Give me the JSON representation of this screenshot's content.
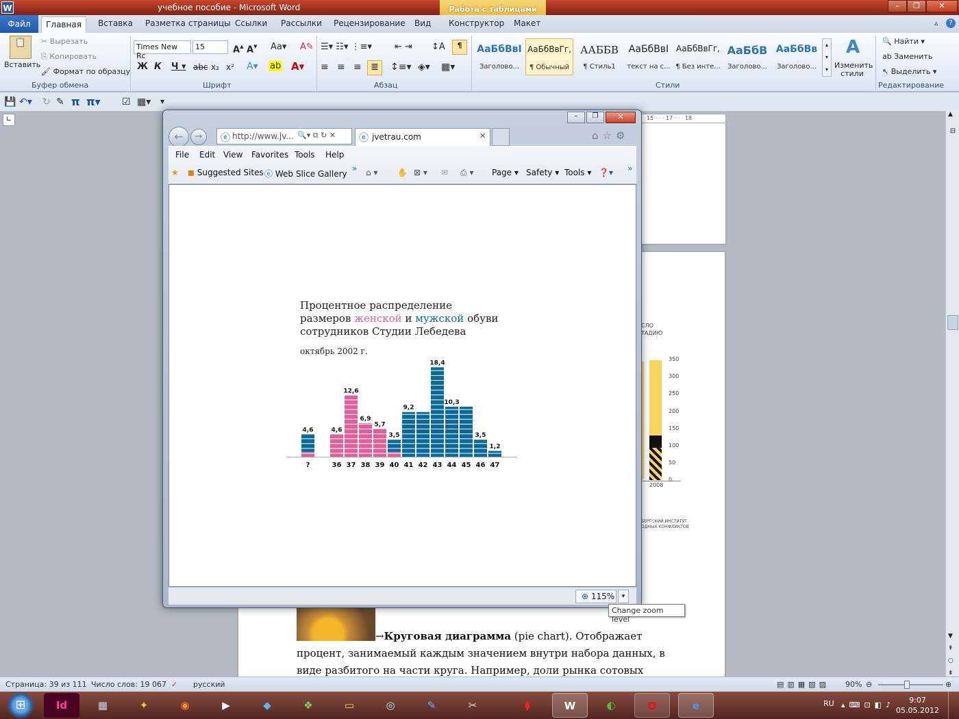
{
  "word": {
    "title": "учебное пособие  -  Microsoft Word",
    "context_tab_group": "Работа с таблицами",
    "tabs": [
      "Файл",
      "Главная",
      "Вставка",
      "Разметка страницы",
      "Ссылки",
      "Рассылки",
      "Рецензирование",
      "Вид",
      "Конструктор",
      "Макет"
    ],
    "clipboard": {
      "paste": "Вставить",
      "cut": "Вырезать",
      "copy": "Копировать",
      "format_painter": "Формат по образцу",
      "label": "Буфер обмена"
    },
    "font": {
      "name": "Times New Rc",
      "size": "15",
      "label": "Шрифт"
    },
    "paragraph_label": "Абзац",
    "styles": [
      {
        "preview": "АаБбВвІ",
        "name": "Заголово..."
      },
      {
        "preview": "АаБбВвГг,",
        "name": "¶ Обычный"
      },
      {
        "preview": "ААББВ",
        "name": "¶ Стиль1"
      },
      {
        "preview": "АаБбВвІ",
        "name": "текст на с..."
      },
      {
        "preview": "АаБбВвГг,",
        "name": "¶ Без инте..."
      },
      {
        "preview": "АаБбВ",
        "name": "Заголово..."
      },
      {
        "preview": "АаБбВв",
        "name": "Заголово..."
      }
    ],
    "change_styles": "Изменить стили",
    "styles_label": "Стили",
    "editing": {
      "find": "Найти",
      "replace": "Заменить",
      "select": "Выделить",
      "label": "Редактирование"
    },
    "ruler_text": "15 · · · 17 · · · 18",
    "doc_text": {
      "bold": "Круговая диаграмма",
      "line1_rest": "(pie chart). Отображает",
      "line2": "процент, занимаемый каждым значением внутри набора данных, в",
      "line3": "виде разбитого на части круга. Например, доли рынка сотовых"
    },
    "bg_chart": {
      "heading_lines": [
        "СЛО",
        "ТАДИЮ"
      ],
      "ticks": [
        "350",
        "300",
        "250",
        "200",
        "150",
        "100",
        "50",
        "0"
      ],
      "xlabel": "2008",
      "source_lines": [
        "БЕРГСКИЙ ИНСТИТУТ",
        "ОДНЫХ КОНФЛИКТОВ"
      ]
    },
    "status": {
      "page": "Страница: 39 из 111",
      "words": "Число слов: 19 067",
      "language": "русский",
      "zoom": "90%"
    }
  },
  "ie": {
    "address": "http://www.jv...",
    "tab_title": "jvetrau.com",
    "menu": [
      "File",
      "Edit",
      "View",
      "Favorites",
      "Tools",
      "Help"
    ],
    "favorites": [
      "Suggested Sites",
      "Web Slice Gallery"
    ],
    "commands": [
      "Page",
      "Safety",
      "Tools"
    ],
    "zoom": "115%",
    "tooltip": "Change zoom level"
  },
  "chart_data": {
    "type": "bar",
    "title_lines": [
      "Процентное распределение",
      "размеров",
      "женской",
      "и",
      "мужской",
      "обуви",
      "сотрудников Студии Лебедева"
    ],
    "subtitle": "октябрь 2002 г.",
    "categories": [
      "?",
      "36",
      "37",
      "38",
      "39",
      "40",
      "41",
      "42",
      "43",
      "44",
      "45",
      "46",
      "47"
    ],
    "values": [
      4.6,
      4.6,
      12.6,
      6.9,
      5.7,
      3.5,
      9.2,
      9.2,
      18.4,
      10.3,
      10.3,
      3.5,
      1.2
    ],
    "labels": [
      "4,6",
      "4,6",
      "12,6",
      "6,9",
      "5,7",
      "3,5",
      "9,2",
      "",
      "18,4",
      "10,3",
      "",
      "3,5",
      "1,2"
    ],
    "colors_by_gender": [
      "mixed",
      "female",
      "female",
      "female",
      "female",
      "mixed",
      "male",
      "male",
      "male",
      "male",
      "male",
      "male",
      "male"
    ],
    "female_share": [
      1,
      4.6,
      12.6,
      6.9,
      5.7,
      1,
      0,
      0,
      0,
      0,
      0,
      0,
      0
    ],
    "colors": {
      "female": "#e0609a",
      "male": "#0b6a9c"
    }
  }
}
